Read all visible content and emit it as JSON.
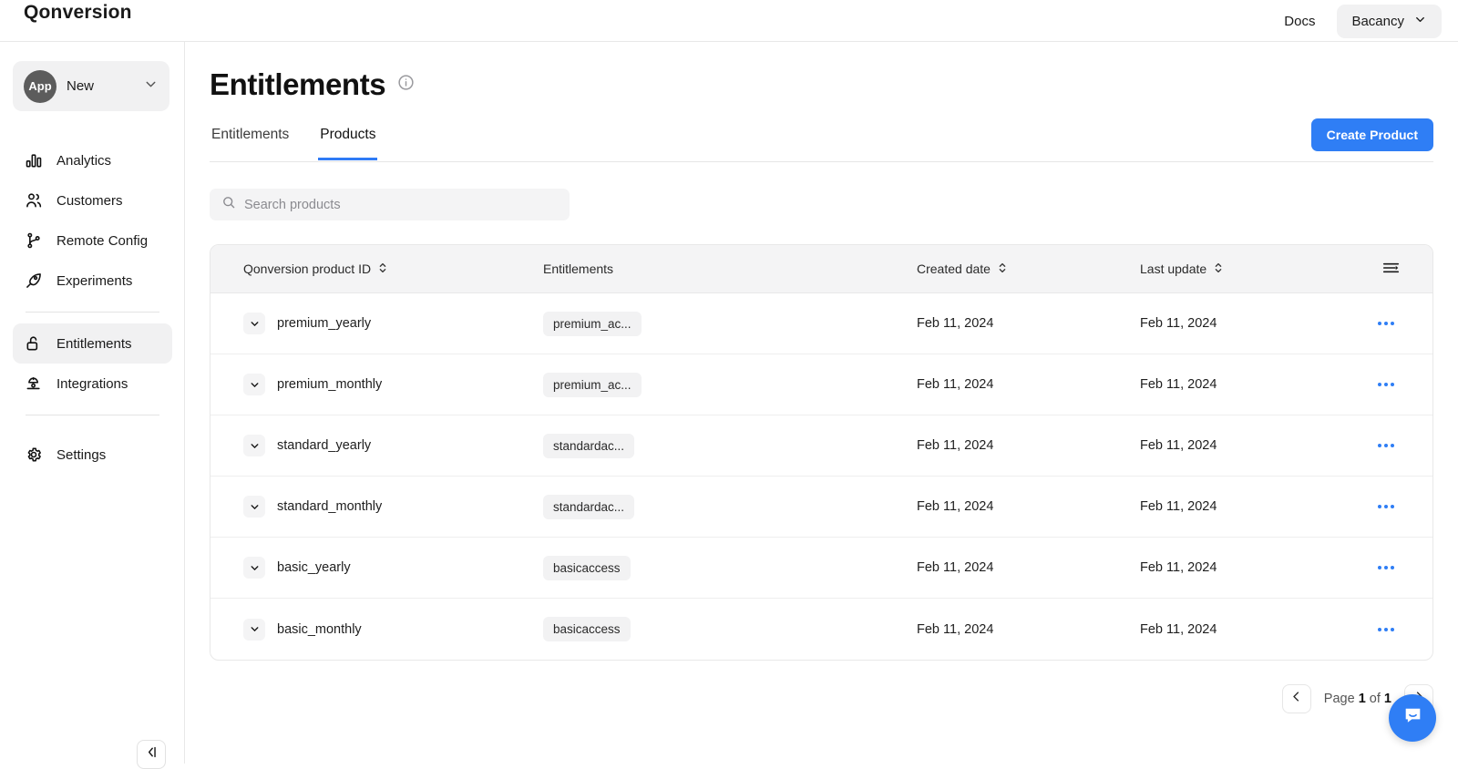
{
  "topbar": {
    "brand": "Qonversion",
    "docs_label": "Docs",
    "account_label": "Bacancy"
  },
  "sidebar": {
    "workspace": {
      "avatar_label": "App",
      "name": "New"
    },
    "items": [
      {
        "label": "Analytics",
        "icon": "bar-chart-icon",
        "active": false
      },
      {
        "label": "Customers",
        "icon": "users-icon",
        "active": false
      },
      {
        "label": "Remote Config",
        "icon": "branch-icon",
        "active": false
      },
      {
        "label": "Experiments",
        "icon": "rocket-icon",
        "active": false
      },
      {
        "label": "Entitlements",
        "icon": "unlock-icon",
        "active": true
      },
      {
        "label": "Integrations",
        "icon": "integrations-icon",
        "active": false
      },
      {
        "label": "Settings",
        "icon": "gear-icon",
        "active": false
      }
    ],
    "collapse_icon": "collapse-sidebar-icon"
  },
  "page": {
    "title": "Entitlements",
    "info_icon": "info-icon",
    "tabs": [
      {
        "label": "Entitlements",
        "active": false
      },
      {
        "label": "Products",
        "active": true
      }
    ],
    "create_button": "Create Product"
  },
  "search": {
    "placeholder": "Search products",
    "value": "",
    "icon": "search-icon"
  },
  "table": {
    "columns": [
      {
        "label": "Qonversion product ID",
        "sortable": true
      },
      {
        "label": "Entitlements",
        "sortable": false
      },
      {
        "label": "Created date",
        "sortable": true
      },
      {
        "label": "Last update",
        "sortable": true
      }
    ],
    "settings_icon": "column-settings-icon",
    "rows": [
      {
        "product_id": "premium_yearly",
        "entitlement": "premium_ac...",
        "created": "Feb 11, 2024",
        "updated": "Feb 11, 2024"
      },
      {
        "product_id": "premium_monthly",
        "entitlement": "premium_ac...",
        "created": "Feb 11, 2024",
        "updated": "Feb 11, 2024"
      },
      {
        "product_id": "standard_yearly",
        "entitlement": "standardac...",
        "created": "Feb 11, 2024",
        "updated": "Feb 11, 2024"
      },
      {
        "product_id": "standard_monthly",
        "entitlement": "standardac...",
        "created": "Feb 11, 2024",
        "updated": "Feb 11, 2024"
      },
      {
        "product_id": "basic_yearly",
        "entitlement": "basicaccess",
        "created": "Feb 11, 2024",
        "updated": "Feb 11, 2024"
      },
      {
        "product_id": "basic_monthly",
        "entitlement": "basicaccess",
        "created": "Feb 11, 2024",
        "updated": "Feb 11, 2024"
      }
    ]
  },
  "pagination": {
    "prev_icon": "chevron-left-icon",
    "page_prefix": "Page",
    "current_page": "1",
    "page_separator": "of",
    "total_pages": "1"
  },
  "chat": {
    "icon": "intercom-chat-icon"
  },
  "colors": {
    "accent": "#2f7ef5",
    "surface": "#f4f4f5",
    "text": "#1a1a1a",
    "border": "#e8e8e8"
  }
}
